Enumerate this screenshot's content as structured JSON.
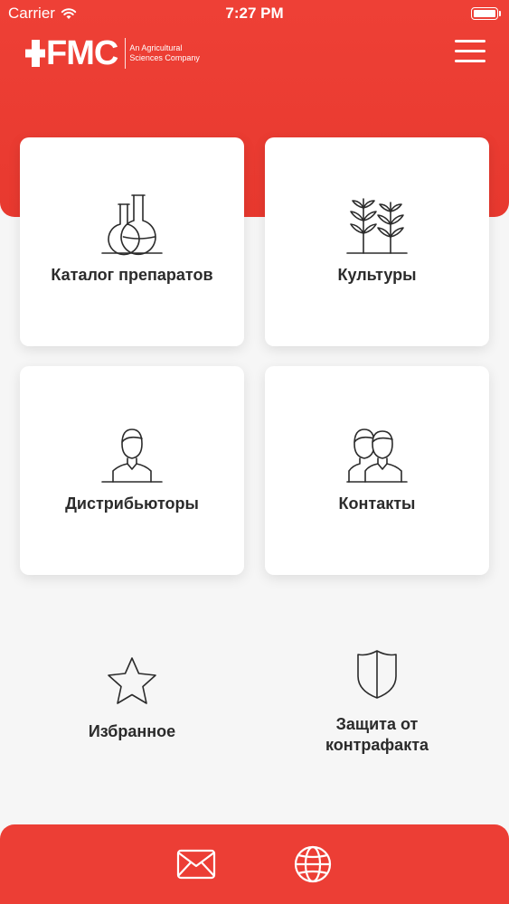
{
  "status_bar": {
    "carrier": "Carrier",
    "time": "7:27 PM"
  },
  "header": {
    "brand": "FMC",
    "tagline_line1": "An Agricultural",
    "tagline_line2": "Sciences Company"
  },
  "cards": [
    {
      "label": "Каталог препаратов",
      "icon": "flasks-icon"
    },
    {
      "label": "Культуры",
      "icon": "plants-icon"
    },
    {
      "label": "Дистрибьюторы",
      "icon": "person-icon"
    },
    {
      "label": "Контакты",
      "icon": "people-icon"
    }
  ],
  "tiles": [
    {
      "label": "Избранное",
      "icon": "star-icon"
    },
    {
      "label_line1": "Защита от",
      "label_line2": "контрафакта",
      "icon": "shield-icon"
    }
  ],
  "bottom_bar": {
    "icons": [
      "mail-icon",
      "globe-icon"
    ]
  },
  "colors": {
    "accent": "#ee4036",
    "background": "#f6f6f6",
    "text": "#2b2b2b"
  }
}
